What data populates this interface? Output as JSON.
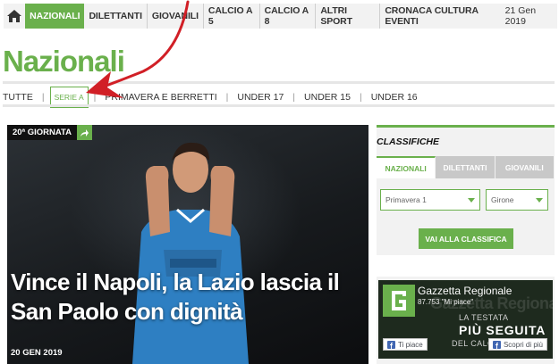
{
  "nav": {
    "items": [
      {
        "label": "NAZIONALI",
        "active": true
      },
      {
        "label": "DILETTANTI"
      },
      {
        "label": "GIOVANILI"
      },
      {
        "label": "CALCIO A 5"
      },
      {
        "label": "CALCIO A 8"
      },
      {
        "label": "ALTRI SPORT"
      },
      {
        "label": "CRONACA CULTURA EVENTI"
      }
    ],
    "date": "21 Gen 2019"
  },
  "page_title": "Nazionali",
  "subnav": {
    "items": [
      "TUTTE",
      "SERIE A",
      "PRIMAVERA E BERRETTI",
      "UNDER 17",
      "UNDER 15",
      "UNDER 16"
    ],
    "selected": "SERIE A"
  },
  "hero": {
    "tag": "20ª GIORNATA",
    "headline": "Vince il Napoli, la Lazio lascia il San Paolo con dignità",
    "date": "20 GEN 2019"
  },
  "classifiche": {
    "title": "CLASSIFICHE",
    "tabs": [
      "NAZIONALI",
      "DILETTANTI",
      "GIOVANILI"
    ],
    "select1": "Primavera 1",
    "select2": "Girone",
    "button": "VAI ALLA CLASSIFICA"
  },
  "fb": {
    "name": "Gazzetta Regionale",
    "fans": "87.753 \"Mi piace\"",
    "bg_text": "Gazzetta Regionale",
    "line1": "LA TESTATA",
    "line2": "PIÙ SEGUITA",
    "line3": "DEL CALCIO LAZ",
    "like": "Ti piace",
    "discover": "Scopri di più"
  },
  "colors": {
    "accent": "#6ab04c",
    "nav_bg": "#f2f2f2",
    "annotation": "#d11f26"
  }
}
